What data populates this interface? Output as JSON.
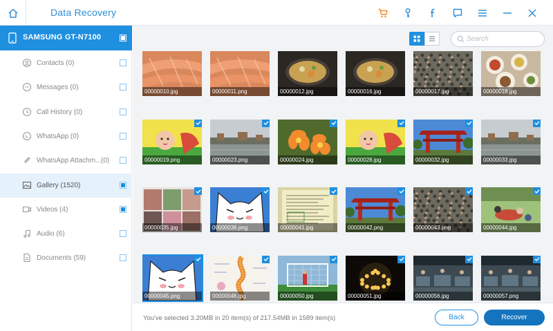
{
  "titlebar": {
    "title": "Data Recovery",
    "icons": [
      "home-icon",
      "cart-icon",
      "key-icon",
      "facebook-icon",
      "chat-icon",
      "menu-icon",
      "minimize-icon",
      "close-icon"
    ],
    "cart_color": "#f08a24",
    "accent": "#2f8ed6"
  },
  "sidebar": {
    "device": {
      "name": "SAMSUNG GT-N7100",
      "checked": true
    },
    "categories": [
      {
        "label": "Contacts (0)",
        "count": "",
        "icon": "contacts-icon",
        "checked": false,
        "active": false
      },
      {
        "label": "Messages (0)",
        "count": "",
        "icon": "messages-icon",
        "checked": false,
        "active": false
      },
      {
        "label": "Call History (0)",
        "count": "",
        "icon": "call-history-icon",
        "checked": false,
        "active": false
      },
      {
        "label": "WhatsApp (0)",
        "count": "",
        "icon": "whatsapp-icon",
        "checked": false,
        "active": false
      },
      {
        "label": "WhatsApp Attachm...",
        "count": "(0)",
        "icon": "attachment-icon",
        "checked": false,
        "active": false
      },
      {
        "label": "Gallery (1520)",
        "count": "",
        "icon": "gallery-icon",
        "checked": true,
        "active": true
      },
      {
        "label": "Videos (4)",
        "count": "",
        "icon": "videos-icon",
        "checked": true,
        "active": false
      },
      {
        "label": "Audio (6)",
        "count": "",
        "icon": "audio-icon",
        "checked": false,
        "active": false
      },
      {
        "label": "Documents (59)",
        "count": "",
        "icon": "documents-icon",
        "checked": false,
        "active": false
      }
    ]
  },
  "toolbar": {
    "search_placeholder": "Search",
    "view_mode": "grid"
  },
  "gallery": {
    "items": [
      {
        "name": "00000010.jpg",
        "checked": false,
        "scene": "salmon"
      },
      {
        "name": "00000011.png",
        "checked": false,
        "scene": "salmon"
      },
      {
        "name": "00000012.jpg",
        "checked": false,
        "scene": "pan"
      },
      {
        "name": "00000016.jpg",
        "checked": false,
        "scene": "pan"
      },
      {
        "name": "00000017.jpg",
        "checked": false,
        "scene": "crowd"
      },
      {
        "name": "00000018.jpg",
        "checked": false,
        "scene": "dishes"
      },
      {
        "name": "00000019.png",
        "checked": true,
        "scene": "baby"
      },
      {
        "name": "00000023.png",
        "checked": true,
        "scene": "river"
      },
      {
        "name": "00000024.jpg",
        "checked": true,
        "scene": "flower"
      },
      {
        "name": "00000028.jpg",
        "checked": true,
        "scene": "baby"
      },
      {
        "name": "00000032.jpg",
        "checked": true,
        "scene": "gate"
      },
      {
        "name": "00000033.jpg",
        "checked": true,
        "scene": "river"
      },
      {
        "name": "00000035.jpg",
        "checked": true,
        "scene": "collage"
      },
      {
        "name": "00000036.png",
        "checked": true,
        "scene": "cat"
      },
      {
        "name": "00000041.jpg",
        "checked": true,
        "scene": "document"
      },
      {
        "name": "00000042.png",
        "checked": true,
        "scene": "gate"
      },
      {
        "name": "00000043.png",
        "checked": true,
        "scene": "crowd"
      },
      {
        "name": "00000044.jpg",
        "checked": true,
        "scene": "picnic"
      },
      {
        "name": "00000045.png",
        "checked": true,
        "scene": "cat",
        "selected": true
      },
      {
        "name": "00000046.jpg",
        "checked": true,
        "scene": "spine"
      },
      {
        "name": "00000050.jpg",
        "checked": true,
        "scene": "soccer"
      },
      {
        "name": "00000051.jpg",
        "checked": true,
        "scene": "candles"
      },
      {
        "name": "00000056.jpg",
        "checked": true,
        "scene": "market"
      },
      {
        "name": "00000057.png",
        "checked": true,
        "scene": "market"
      }
    ]
  },
  "footer": {
    "status": "You've selected 3.20MB in 20 item(s) of 217.54MB in 1589 item(s)",
    "back_label": "Back",
    "recover_label": "Recover"
  }
}
